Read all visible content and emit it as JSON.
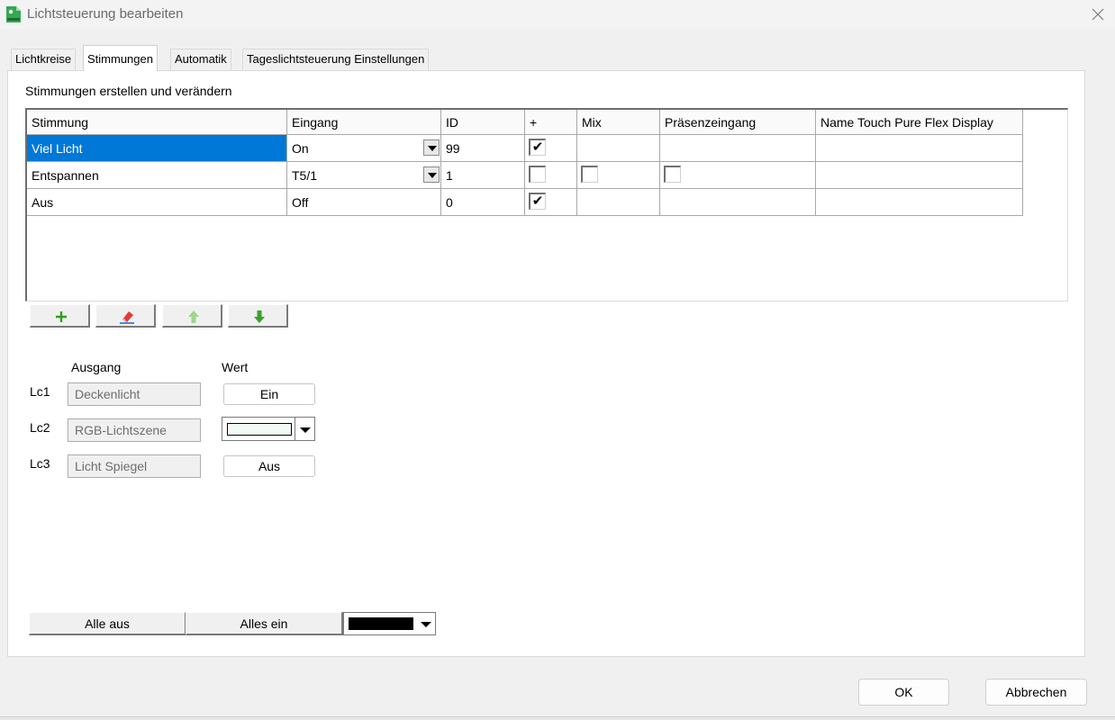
{
  "window": {
    "title": "Lichtsteuerung bearbeiten"
  },
  "tabs": [
    {
      "label": "Lichtkreise",
      "active": false
    },
    {
      "label": "Stimmungen",
      "active": true
    },
    {
      "label": "Automatik",
      "active": false
    },
    {
      "label": "Tageslichtsteuerung Einstellungen",
      "active": false
    }
  ],
  "section_title": "Stimmungen erstellen und verändern",
  "grid": {
    "headers": [
      "Stimmung",
      "Eingang",
      "ID",
      "+",
      "Mix",
      "Präsenzeingang",
      "Name Touch Pure Flex Display"
    ],
    "rows": [
      {
        "stimmung": "Viel Licht",
        "eingang": "On",
        "id": "99",
        "plus_checked": true,
        "selected": true
      },
      {
        "stimmung": "Entspannen",
        "eingang": "T5/1",
        "id": "1",
        "plus_checked": false,
        "mix_checked": false,
        "praesenz_checked": false
      },
      {
        "stimmung": "Aus",
        "eingang": "Off",
        "id": "0",
        "plus_checked": true
      }
    ]
  },
  "toolbar": {
    "add": "plus-icon",
    "erase": "eraser-icon",
    "up": "arrow-up-icon",
    "down": "arrow-down-icon"
  },
  "outputs": {
    "header_ausgang": "Ausgang",
    "header_wert": "Wert",
    "rows": [
      {
        "label": "Lc1",
        "name": "Deckenlicht",
        "value": "Ein"
      },
      {
        "label": "Lc2",
        "name": "RGB-Lichtszene",
        "color": "#f2faf4"
      },
      {
        "label": "Lc3",
        "name": "Licht Spiegel",
        "value": "Aus"
      }
    ]
  },
  "bottom": {
    "alle_aus": "Alle aus",
    "alles_ein": "Alles ein",
    "color": "#000000"
  },
  "dialog": {
    "ok": "OK",
    "cancel": "Abbrechen"
  },
  "colors": {
    "selection": "#0078d7",
    "plus_green": "#2e9e1a",
    "arrow_green": "#3aa12a",
    "arrow_light_green": "#9ed68c"
  }
}
